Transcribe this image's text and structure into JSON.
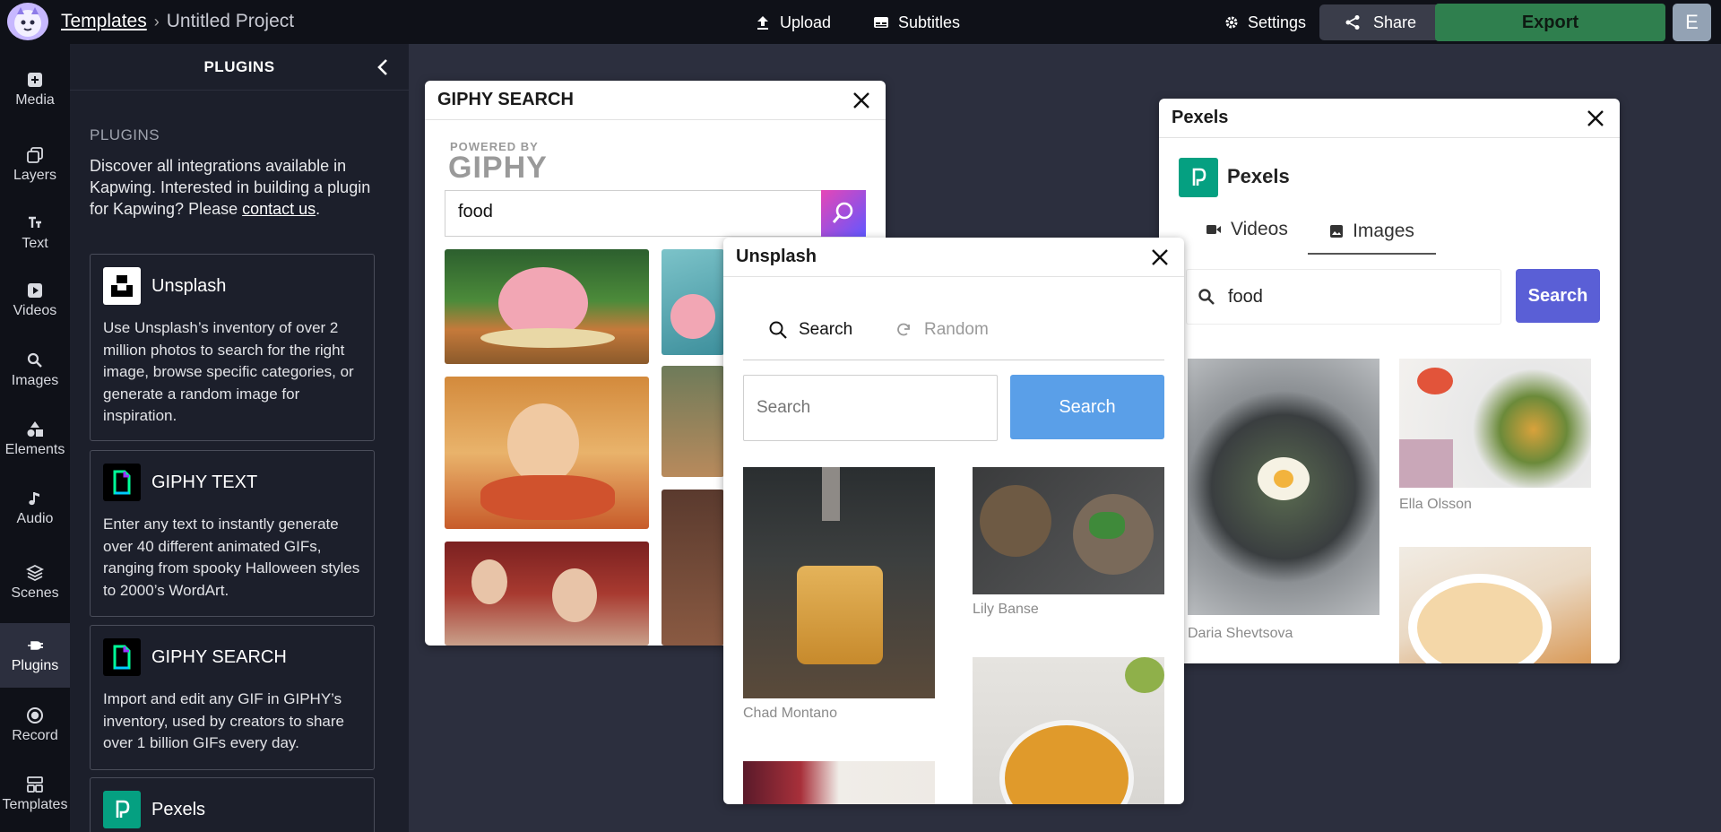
{
  "topbar": {
    "breadcrumb_link": "Templates",
    "breadcrumb_sep": "›",
    "project_title": "Untitled Project",
    "upload_label": "Upload",
    "subtitles_label": "Subtitles",
    "settings_label": "Settings",
    "share_label": "Share",
    "export_label": "Export",
    "avatar_letter": "E"
  },
  "nav": [
    {
      "label": "Media",
      "icon": "media-plus-icon"
    },
    {
      "label": "Layers",
      "icon": "layers-icon"
    },
    {
      "label": "Text",
      "icon": "text-icon"
    },
    {
      "label": "Videos",
      "icon": "video-play-icon"
    },
    {
      "label": "Images",
      "icon": "search-icon"
    },
    {
      "label": "Elements",
      "icon": "elements-icon"
    },
    {
      "label": "Audio",
      "icon": "music-note-icon"
    },
    {
      "label": "Scenes",
      "icon": "scenes-stack-icon"
    },
    {
      "label": "Plugins",
      "icon": "plug-icon"
    },
    {
      "label": "Record",
      "icon": "record-icon"
    },
    {
      "label": "Templates",
      "icon": "templates-icon"
    }
  ],
  "panel": {
    "title": "PLUGINS",
    "subtitle": "PLUGINS",
    "desc_prefix": "Discover all integrations available in Kapwing. Interested in building a plugin for Kapwing? Please ",
    "desc_link": "contact us",
    "desc_suffix": ".",
    "cards": [
      {
        "title": "Unsplash",
        "desc": "Use Unsplash’s inventory of over 2 million photos to search for the right image, browse specific categories, or generate a random image for inspiration."
      },
      {
        "title": "GIPHY TEXT",
        "desc": "Enter any text to instantly generate over 40 different animated GIFs, ranging from spooky Halloween styles to 2000’s WordArt."
      },
      {
        "title": "GIPHY SEARCH",
        "desc": "Import and edit any GIF in GIPHY’s inventory, used by creators to share over 1 billion GIFs every day."
      },
      {
        "title": "Pexels",
        "desc": ""
      }
    ]
  },
  "giphy": {
    "title": "GIPHY SEARCH",
    "powered_by": "POWERED BY",
    "brand": "GIPHY",
    "query": "food"
  },
  "unsplash": {
    "title": "Unsplash",
    "tab_search": "Search",
    "tab_random": "Random",
    "search_placeholder": "Search",
    "search_button": "Search",
    "captions": [
      "Chad Montano",
      "Lily Banse"
    ]
  },
  "pexels": {
    "title": "Pexels",
    "brand": "Pexels",
    "tab_videos": "Videos",
    "tab_images": "Images",
    "query": "food",
    "search_button": "Search",
    "captions": [
      "Daria Shevtsova",
      "Ella Olsson"
    ]
  },
  "colors": {
    "export_green": "#2f7f4e",
    "giphy_purple": "#9933ff",
    "unsplash_blue": "#5a9fe8",
    "pexels_green": "#05a081",
    "pexels_button": "#5a5fd6"
  }
}
